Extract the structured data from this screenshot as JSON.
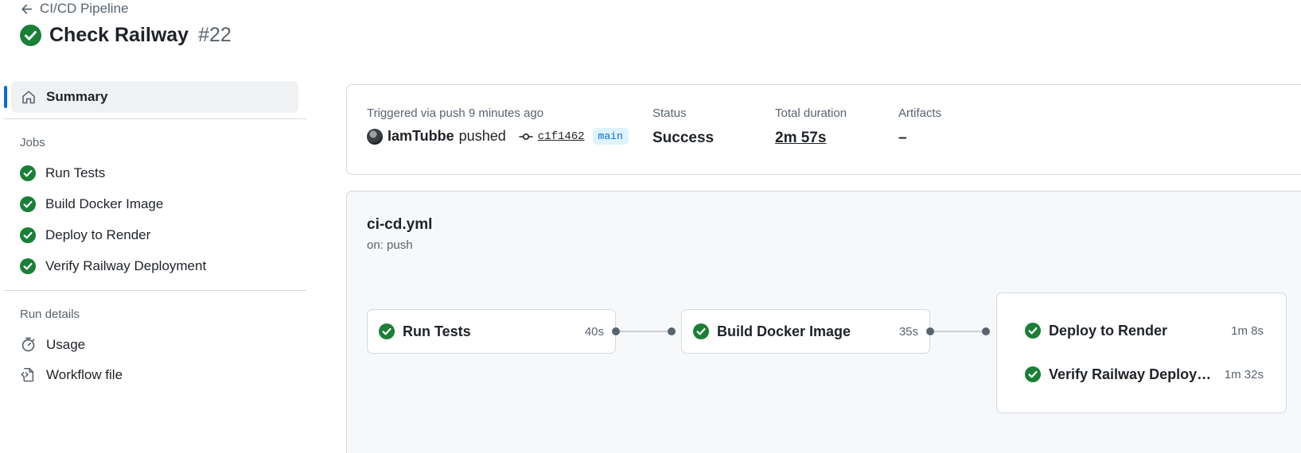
{
  "header": {
    "back_label": "CI/CD Pipeline",
    "title": "Check Railway",
    "run_number": "#22"
  },
  "sidebar": {
    "summary_label": "Summary",
    "jobs_heading": "Jobs",
    "jobs": [
      {
        "label": "Run Tests"
      },
      {
        "label": "Build Docker Image"
      },
      {
        "label": "Deploy to Render"
      },
      {
        "label": "Verify Railway Deployment"
      }
    ],
    "run_details_heading": "Run details",
    "usage_label": "Usage",
    "workflow_file_label": "Workflow file"
  },
  "summary": {
    "trigger_label": "Triggered via push 9 minutes ago",
    "actor": "IamTubbe",
    "action": "pushed",
    "commit_sha": "c1f1462",
    "branch": "main",
    "status_label": "Status",
    "status_value": "Success",
    "duration_label": "Total duration",
    "duration_value": "2m 57s",
    "artifacts_label": "Artifacts",
    "artifacts_value": "–"
  },
  "workflow": {
    "file_name": "ci-cd.yml",
    "trigger": "on: push",
    "jobs": [
      {
        "name": "Run Tests",
        "duration": "40s"
      },
      {
        "name": "Build Docker Image",
        "duration": "35s"
      },
      {
        "name": "Deploy to Render",
        "duration": "1m 8s"
      },
      {
        "name": "Verify Railway Deploym...",
        "duration": "1m 32s"
      }
    ]
  },
  "colors": {
    "success": "#1a7f37",
    "accent": "#0969da",
    "muted_text": "#59636e",
    "border": "#d1d9e0"
  },
  "icons": {
    "back": "arrow-left-icon",
    "success": "check-circle-fill-icon",
    "summary": "home-icon",
    "usage": "stopwatch-icon",
    "workflow_file": "file-code-icon",
    "commit": "git-commit-icon"
  }
}
